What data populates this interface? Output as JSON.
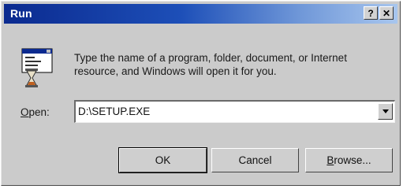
{
  "window": {
    "title": "Run",
    "help_label": "?",
    "close_label": "✕"
  },
  "description": "Type the name of a program, folder, document, or Internet resource, and Windows will open it for you.",
  "open": {
    "label_first": "O",
    "label_rest": "pen:",
    "value": "D:\\SETUP.EXE"
  },
  "buttons": {
    "ok": "OK",
    "cancel": "Cancel",
    "browse_first": "B",
    "browse_rest": "rowse..."
  },
  "icons": {
    "run": "run-program-icon",
    "dropdown": "chevron-down-icon"
  },
  "colors": {
    "dialog_bg": "#cbcbcb",
    "titlebar_start": "#0b2a8f",
    "titlebar_end": "#a8c6ee"
  }
}
